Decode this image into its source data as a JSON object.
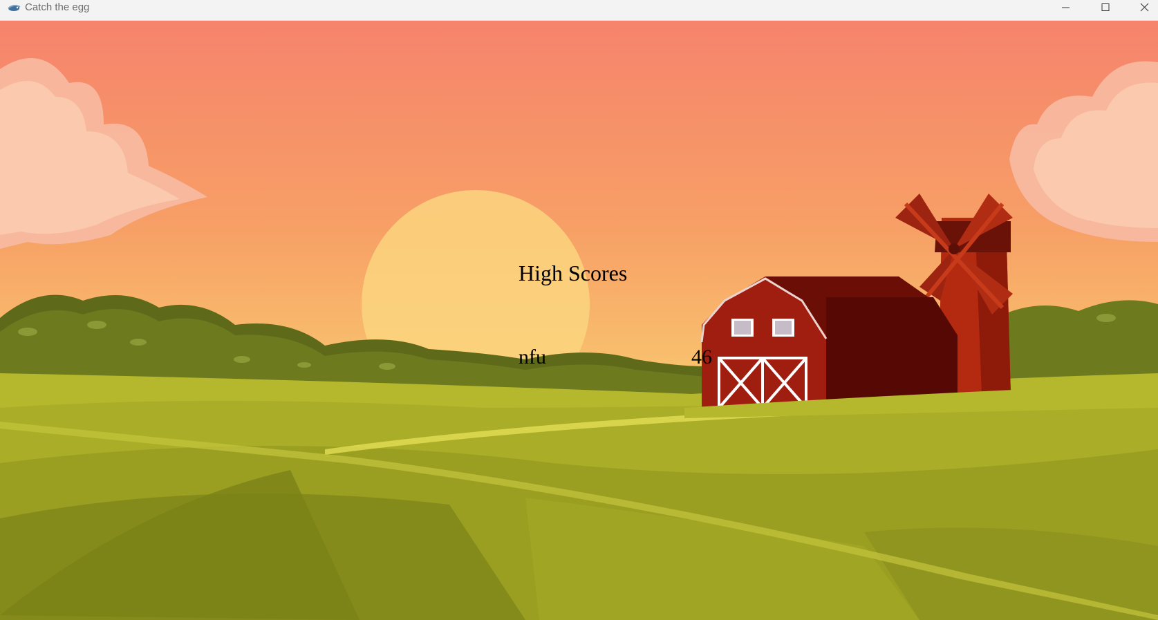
{
  "window": {
    "title": "Catch the egg",
    "icon": "bird-app-icon",
    "controls": [
      "minimize-icon",
      "maximize-icon",
      "close-icon"
    ]
  },
  "scene": {
    "background": "farm-sunset",
    "colors": {
      "sky_top": "#f6836c",
      "sky_bottom": "#fbd378",
      "field": "#a4a824",
      "barn": "#a01e10",
      "windmill": "#b42a10"
    }
  },
  "high_scores": {
    "title": "High Scores",
    "entries": [
      {
        "name": "nfu",
        "score": "46"
      }
    ]
  }
}
